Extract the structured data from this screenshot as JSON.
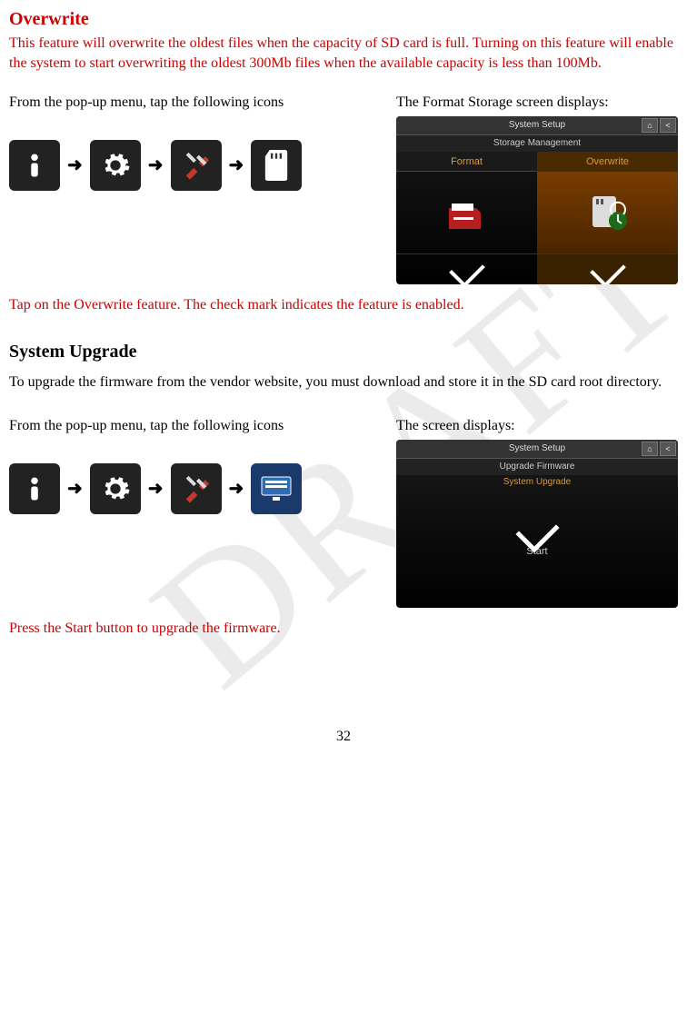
{
  "watermark": "DRAFT",
  "overwrite": {
    "heading": "Overwrite",
    "intro": "This feature will overwrite the oldest files when the capacity of SD card is full. Turning on this feature will enable the system to start overwriting the oldest 300Mb files when the available capacity is less than 100Mb.",
    "left_label": "From the pop-up menu, tap the following icons",
    "right_label": "The Format Storage screen displays:",
    "tap_note": "Tap on the Overwrite feature. The check mark indicates the feature is enabled."
  },
  "screenshot1": {
    "title": "System Setup",
    "subtitle": "Storage Management",
    "tab1": "Format",
    "tab2": "Overwrite"
  },
  "upgrade": {
    "heading": "System Upgrade",
    "intro": "To upgrade the firmware from the vendor website, you must download and store it in the SD card root directory.",
    "left_label": "From the pop-up menu, tap the following icons",
    "right_label": "The screen displays:",
    "press_note": "Press the Start button to upgrade the firmware."
  },
  "screenshot2": {
    "title": "System Setup",
    "subtitle": "Upgrade Firmware",
    "subtitle2": "System Upgrade",
    "start": "Start"
  },
  "arrows": {
    "a": "➜"
  },
  "page": "32"
}
